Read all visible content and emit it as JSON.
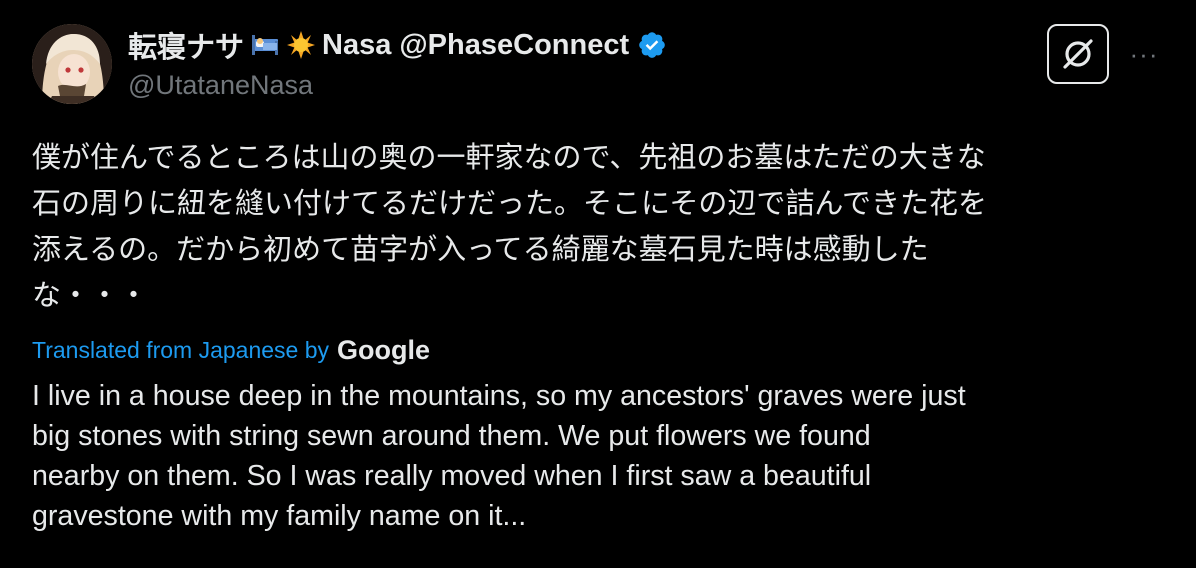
{
  "author": {
    "display_name_prefix": "転寝ナサ",
    "display_name_suffix": "Nasa @PhaseConnect",
    "handle": "@UtataneNasa",
    "verified": true,
    "bed_emoji": "bed-emoji",
    "sun_emoji": "sun-emoji"
  },
  "toolbar": {
    "grok_icon": "grok-icon",
    "more_label": "···"
  },
  "post": {
    "original_lines": [
      "僕が住んでるところは山の奥の一軒家なので、先祖のお墓はただの大きな",
      "石の周りに紐を縫い付けてるだけだった。そこにその辺で詰んできた花を",
      "添えるの。だから初めて苗字が入ってる綺麗な墓石見た時は感動した",
      "な・・・"
    ],
    "translated_from": "Translated from Japanese by",
    "translation_provider": "Google",
    "translated_lines": [
      "I live in a house deep in the mountains, so my ancestors' graves were just",
      "big stones with string sewn around them. We put flowers we found",
      "nearby on them. So I was really moved when I first saw a beautiful",
      "gravestone with my family name on it..."
    ]
  },
  "colors": {
    "background": "#000000",
    "text": "#e7e9ea",
    "secondary": "#71767b",
    "accent": "#1d9bf0"
  }
}
